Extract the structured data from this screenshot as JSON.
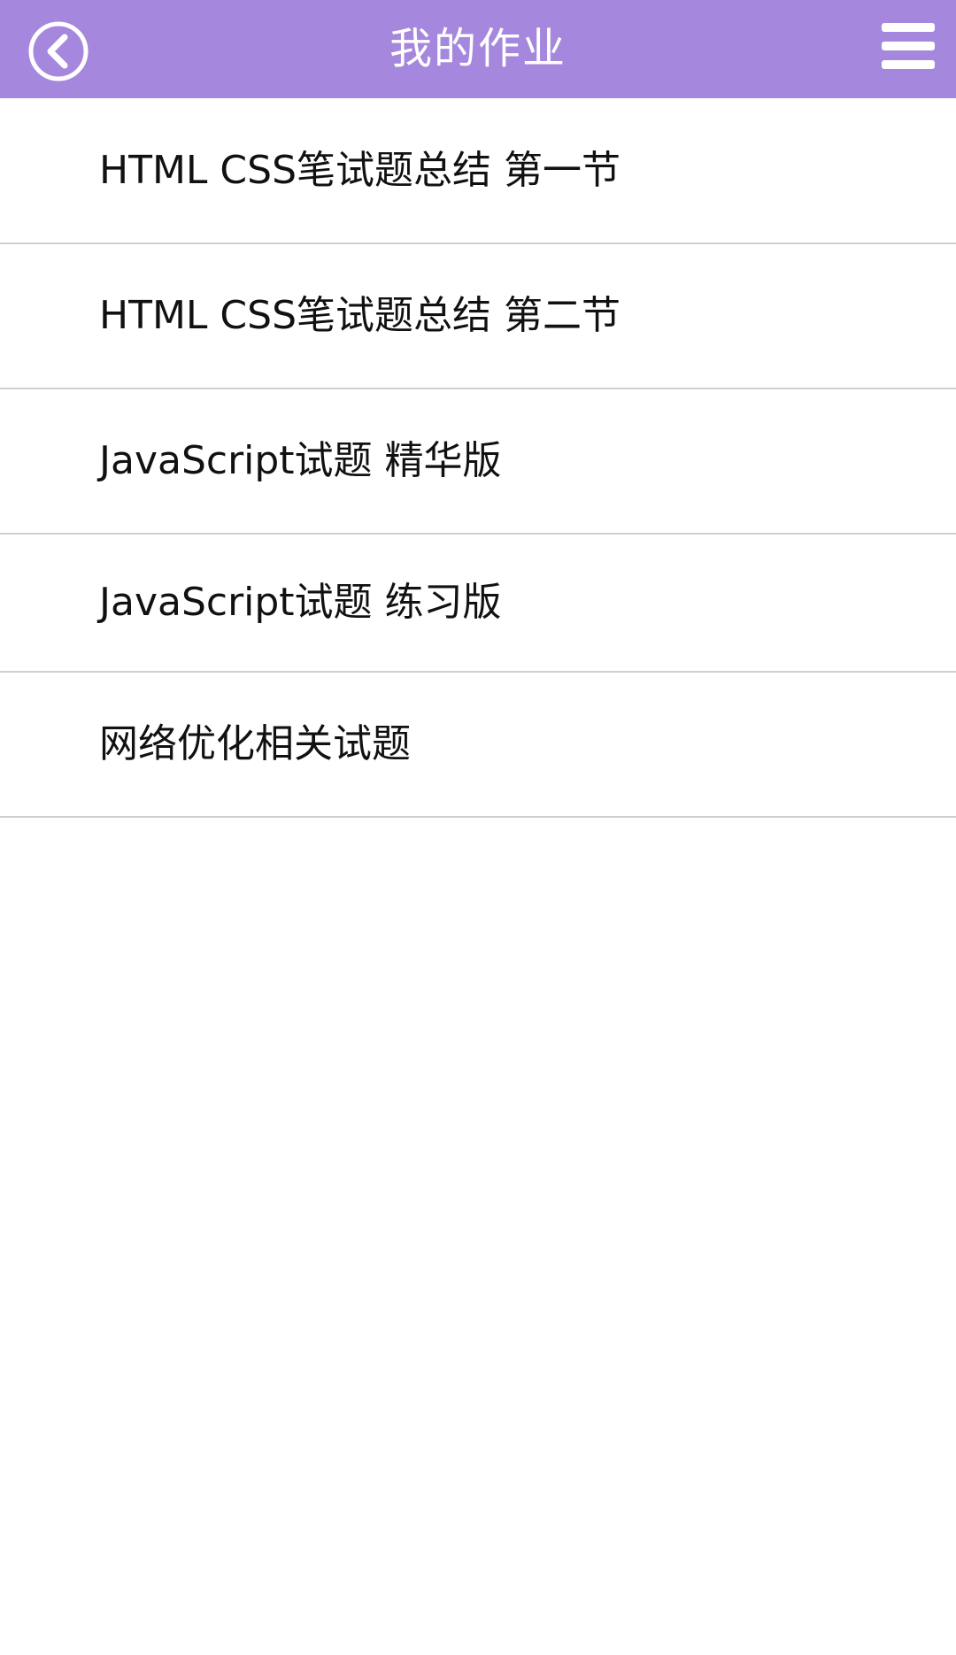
{
  "header": {
    "title": "我的作业",
    "back_icon": "chevron-left-circle-icon",
    "menu_icon": "hamburger-menu-icon",
    "background_color": "#a588dd",
    "text_color": "#ffffff"
  },
  "homework_list": {
    "items": [
      {
        "label": "HTML CSS笔试题总结 第一节"
      },
      {
        "label": "HTML CSS笔试题总结 第二节"
      },
      {
        "label": "JavaScript试题 精华版"
      },
      {
        "label": "JavaScript试题 练习版"
      },
      {
        "label": "网络优化相关试题"
      }
    ]
  }
}
